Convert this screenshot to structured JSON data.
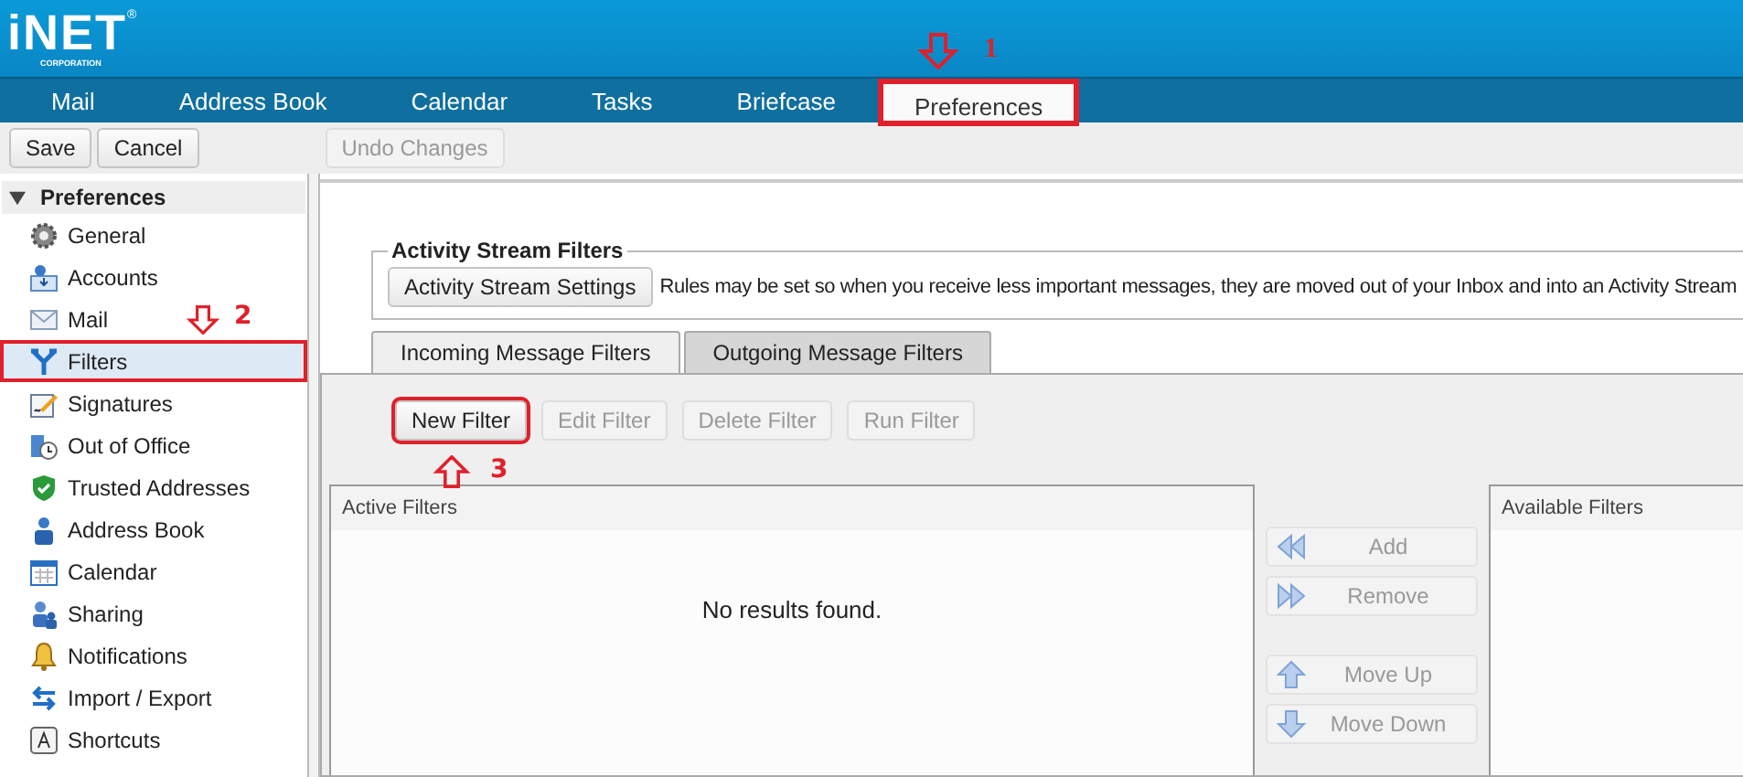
{
  "logo": {
    "name": "iNET",
    "mark": "®",
    "tagline": "CORPORATION"
  },
  "tabs": [
    {
      "label": "Mail",
      "selected": false
    },
    {
      "label": "Address Book",
      "selected": false
    },
    {
      "label": "Calendar",
      "selected": false
    },
    {
      "label": "Tasks",
      "selected": false
    },
    {
      "label": "Briefcase",
      "selected": false
    },
    {
      "label": "Preferences",
      "selected": true,
      "callout": {
        "number": "1",
        "kind": "down"
      }
    }
  ],
  "toolbar": [
    {
      "label": "Save",
      "disabled": false
    },
    {
      "label": "Cancel",
      "disabled": false
    },
    {
      "label": "Undo Changes",
      "disabled": true
    }
  ],
  "sidebar": {
    "title": "Preferences",
    "expanded": true,
    "items": [
      {
        "label": "General",
        "selected": false
      },
      {
        "label": "Accounts",
        "selected": false
      },
      {
        "label": "Mail",
        "selected": false
      },
      {
        "label": "Filters",
        "selected": true,
        "callout": {
          "number": "2",
          "kind": "down"
        }
      },
      {
        "label": "Signatures",
        "selected": false
      },
      {
        "label": "Out of Office",
        "selected": false
      },
      {
        "label": "Trusted Addresses",
        "selected": false
      },
      {
        "label": "Address Book",
        "selected": false
      },
      {
        "label": "Calendar",
        "selected": false
      },
      {
        "label": "Sharing",
        "selected": false
      },
      {
        "label": "Notifications",
        "selected": false
      },
      {
        "label": "Import / Export",
        "selected": false
      },
      {
        "label": "Shortcuts",
        "selected": false
      }
    ]
  },
  "activity_stream": {
    "legend": "Activity Stream Filters",
    "button": "Activity Stream Settings",
    "description": "Rules may be set so when you receive less important messages, they are moved out of your Inbox and into an Activity Stream"
  },
  "filter_tabs": [
    {
      "label": "Incoming Message Filters",
      "selected": true
    },
    {
      "label": "Outgoing Message Filters",
      "selected": false
    }
  ],
  "filter_buttons": [
    {
      "label": "New Filter",
      "disabled": false,
      "callout": {
        "number": "3",
        "kind": "up"
      }
    },
    {
      "label": "Edit Filter",
      "disabled": true
    },
    {
      "label": "Delete Filter",
      "disabled": true
    },
    {
      "label": "Run Filter",
      "disabled": true
    }
  ],
  "active_filters": {
    "title": "Active Filters",
    "empty_text": "No results found."
  },
  "move_buttons": [
    {
      "label": "Add",
      "disabled": true
    },
    {
      "label": "Remove",
      "disabled": true
    },
    {
      "label": "Move Up",
      "disabled": true
    },
    {
      "label": "Move Down",
      "disabled": true
    }
  ],
  "available_filters": {
    "title": "Available Filters"
  }
}
